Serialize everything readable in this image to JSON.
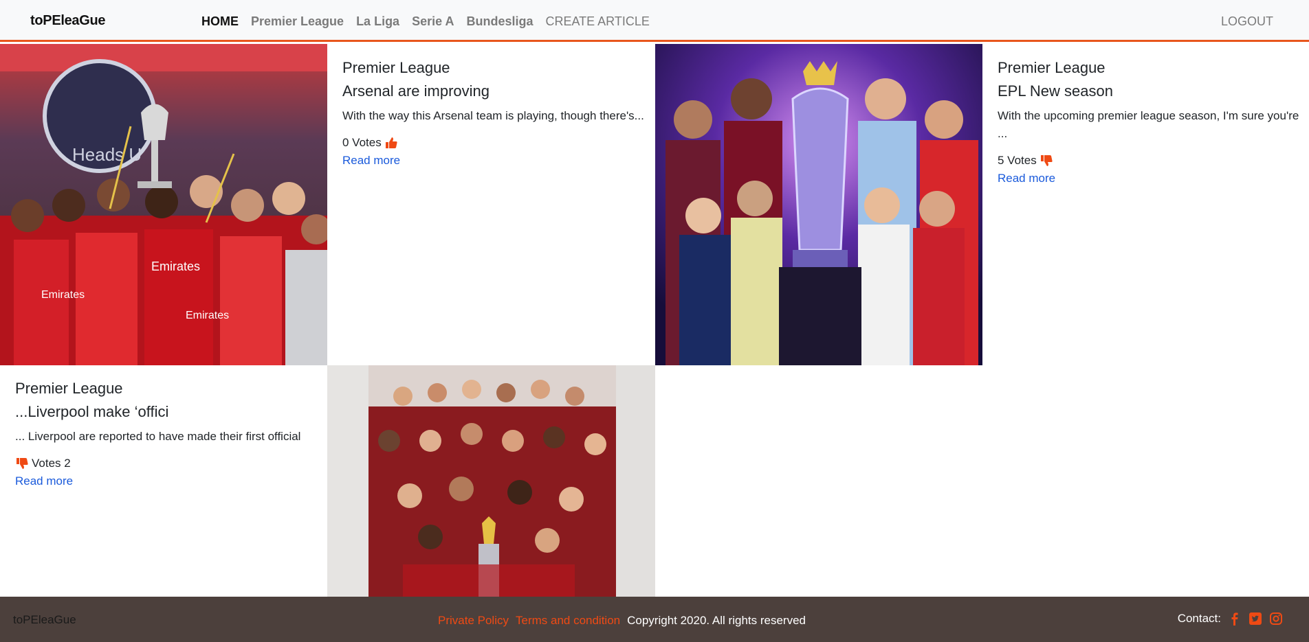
{
  "nav": {
    "brand": "toPEleaGue",
    "home": "HOME",
    "premier": "Premier League",
    "laliga": "La Liga",
    "seriea": "Serie A",
    "bundesliga": "Bundesliga",
    "create": "CREATE ARTICLE",
    "logout": "LOGOUT"
  },
  "cards": [
    {
      "league": "Premier League",
      "title": "Arsenal are improving",
      "excerpt": "With the way this Arsenal team is playing, though there's...",
      "votes": "0 Votes",
      "thumb": "thumbs-up-icon",
      "readmore": "Read more"
    },
    {
      "league": "Premier League",
      "title": "EPL New season",
      "excerpt": "With the upcoming premier league season, I'm sure you're ...",
      "votes": "5 Votes",
      "thumb": "thumbs-down-icon",
      "readmore": "Read more"
    },
    {
      "league": "Premier League",
      "title": "...Liverpool make ‘offici",
      "excerpt": "... Liverpool are reported to have made their first official",
      "votes": "Votes 2",
      "thumb": "thumbs-down-icon",
      "readmore": "Read more"
    }
  ],
  "footer": {
    "brand": "toPEleaGue",
    "privacy": "Private Policy",
    "terms": "Terms and condition",
    "copyright": "Copyright 2020. All rights reserved",
    "contact": "Contact:",
    "icons": [
      "facebook-icon",
      "twitter-icon",
      "instagram-icon"
    ]
  },
  "colors": {
    "accent": "#e8561c",
    "link": "#1a5adb",
    "footer_bg": "#4c403c"
  }
}
